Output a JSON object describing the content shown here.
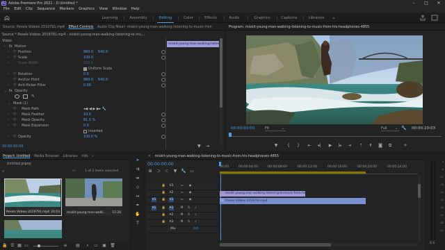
{
  "app": {
    "title": "Adobe Premiere Pro 2021 - D:\\Untitled *",
    "icon_text": "Pr"
  },
  "menu": [
    "File",
    "Edit",
    "Clip",
    "Sequence",
    "Markers",
    "Graphics",
    "View",
    "Window",
    "Help"
  ],
  "workspaces": [
    "Learning",
    "Assembly",
    "Editing",
    "Color",
    "Effects",
    "Audio",
    "Graphics",
    "Captions",
    "Libraries"
  ],
  "active_workspace": "Editing",
  "source_panel": {
    "tabs": [
      "Source: Pexels Videos 2019791.mp4",
      "Effect Controls",
      "Audio Clip Mixer: miskit-young-man-walking-listening-to-music-fron"
    ],
    "active_tab": "Effect Controls",
    "source_label": "Source * Pexels Videos 2019791.mp4",
    "clip_label": "miskit-young-man-walking-listening-to-mu...",
    "timeline_clip": "miskit-young-man-walking-listenin",
    "sections": {
      "video": "Video",
      "opacity": "Opacity"
    },
    "rows": [
      {
        "label": "Motion"
      },
      {
        "label": "Position",
        "value": "960.0",
        "value2": "540.0"
      },
      {
        "label": "Scale",
        "value": "100.0"
      },
      {
        "label": "Scale Width",
        "value": "100.0"
      },
      {
        "label": "Uniform Scale"
      },
      {
        "label": "Rotation",
        "value": "0.0"
      },
      {
        "label": "Anchor Point",
        "value": "960.0",
        "value2": "540.0"
      },
      {
        "label": "Anti-flicker Filter",
        "value": "0.00"
      },
      {
        "label": "Mask (1)"
      },
      {
        "label": "Mask Path"
      },
      {
        "label": "Mask Feather",
        "value": "10.0"
      },
      {
        "label": "Mask Opacity",
        "value": "81.0 %"
      },
      {
        "label": "Mask Expansion",
        "value": "0.0"
      },
      {
        "label": "Inverted"
      },
      {
        "label": "Opacity",
        "value": "100.0 %"
      }
    ],
    "timecode": "00:00:00:00"
  },
  "program_panel": {
    "title": "Program: miskit-young-man-walking-listening-to-music-from-his-headphones-4855",
    "timecode_left": "00:00:00:00",
    "fit": "Fit",
    "quality": "Full",
    "timecode_right": "00:00:20:03"
  },
  "project_panel": {
    "tabs": [
      "Project: Untitled",
      "Media Browser",
      "Libraries",
      "Info"
    ],
    "active_tab": "Project: Untitled",
    "project_file": "Untitled.prproj",
    "items_count": "1 of 3 items selected",
    "items": [
      {
        "name": "Pexels Videos 2019791.mp4",
        "duration": "20:03"
      },
      {
        "name": "miskit-young-man-walki...",
        "duration": "11:26"
      }
    ]
  },
  "timeline": {
    "sequence_name": "miskit-young-man-walking-listening-to-music-from-his-headphones-4855",
    "timecode": "00:00:00:00",
    "ruler": [
      "00:00",
      "00:00:04:00",
      "00:00:08:00",
      "00:00:12:00",
      "00:00:16:00",
      "00:00:20:00",
      "00:00:24:00"
    ],
    "tracks": [
      "V3",
      "V2",
      "V1",
      "A1",
      "A2",
      "A3",
      "Mix"
    ],
    "src_v": "V1",
    "src_a": "A1",
    "mix_value": "0.0",
    "clips": {
      "v2": "miskit-young-man-walking-listening-to-music-from-his-head",
      "v1": "Pexels Videos 2019791.mp4"
    }
  },
  "meters": [
    "0",
    "-6",
    "-12",
    "-18",
    "-24",
    "-30",
    "-36",
    "-42",
    "-48",
    "-54"
  ],
  "colors": {
    "accent": "#4a9fe8",
    "clip_purple": "#9f9ad8",
    "clip_blue": "#7a8fcf"
  }
}
